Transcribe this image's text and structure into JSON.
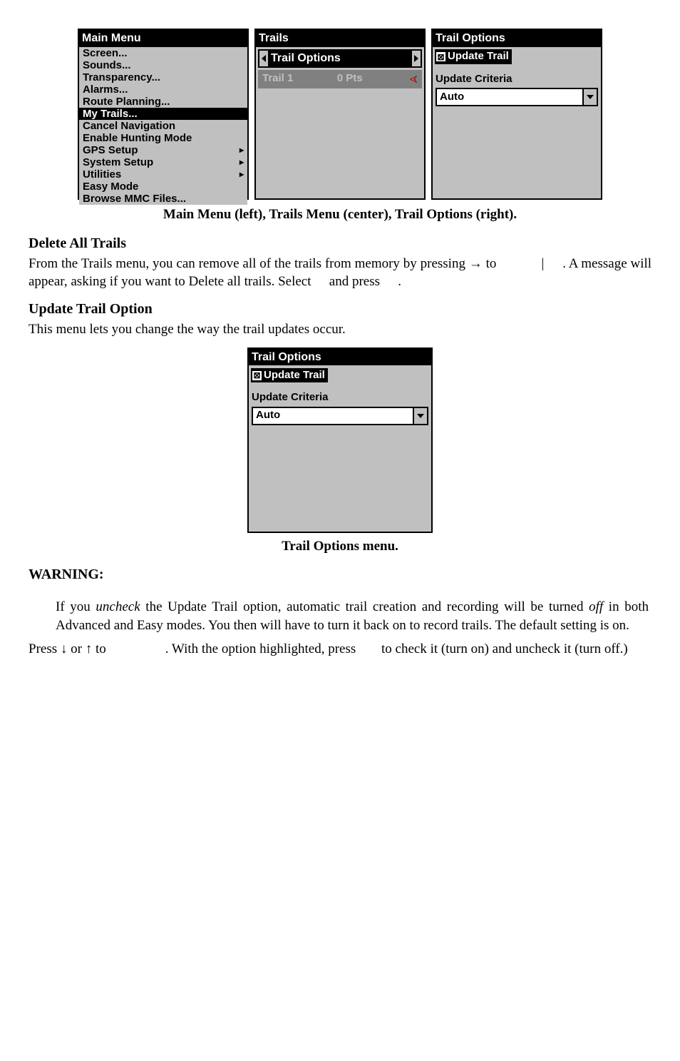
{
  "mainMenu": {
    "title": "Main Menu",
    "items": [
      {
        "label": "Screen...",
        "arrow": false,
        "hl": false
      },
      {
        "label": "Sounds...",
        "arrow": false,
        "hl": false
      },
      {
        "label": "Transparency...",
        "arrow": false,
        "hl": false
      },
      {
        "label": "Alarms...",
        "arrow": false,
        "hl": false
      },
      {
        "label": "Route Planning...",
        "arrow": false,
        "hl": false
      },
      {
        "label": "My Trails...",
        "arrow": false,
        "hl": true
      },
      {
        "label": "Cancel Navigation",
        "arrow": false,
        "hl": false
      },
      {
        "label": "Enable Hunting Mode",
        "arrow": false,
        "hl": false
      },
      {
        "label": "GPS Setup",
        "arrow": true,
        "hl": false
      },
      {
        "label": "System Setup",
        "arrow": true,
        "hl": false
      },
      {
        "label": "Utilities",
        "arrow": true,
        "hl": false
      },
      {
        "label": "Easy Mode",
        "arrow": false,
        "hl": false
      },
      {
        "label": "Browse MMC Files...",
        "arrow": false,
        "hl": false
      }
    ]
  },
  "trailsMenu": {
    "title": "Trails",
    "optionLabel": "Trail Options",
    "trailName": "Trail 1",
    "trailPts": "0 Pts"
  },
  "trailOptions": {
    "title": "Trail Options",
    "updateTrailLabel": "Update Trail",
    "criteriaLabel": "Update Criteria",
    "criteriaValue": "Auto"
  },
  "doc": {
    "caption1": "Main Menu (left), Trails Menu (center), Trail Options (right).",
    "deleteHeading": "Delete All Trails",
    "deleteP_a": "From the Trails menu, you can remove all of the trails from memory by pressing → to ",
    "deleteP_b": "|",
    "deleteP_c": ". A message will appear, asking if you want to Delete all trails. Select ",
    "deleteP_d": "and press ",
    "deleteP_e": ".",
    "updateHeading": "Update Trail Option",
    "updateP": "This menu lets you change the way the trail updates occur.",
    "caption2": "Trail Options menu.",
    "warningHeading": "WARNING:",
    "warningBody_a": "If you ",
    "warningBody_b": "uncheck",
    "warningBody_c": " the Update Trail option, automatic trail creation and recording will be turned ",
    "warningBody_d": "off",
    "warningBody_e": " in both Advanced and Easy modes. You then will have to turn it back on to record trails. The default setting is on.",
    "pressP_a": "Press ↓ or ↑ to ",
    "pressP_b": ". With the option highlighted, press ",
    "pressP_c": "to check it (turn on) and uncheck it (turn off.)"
  }
}
